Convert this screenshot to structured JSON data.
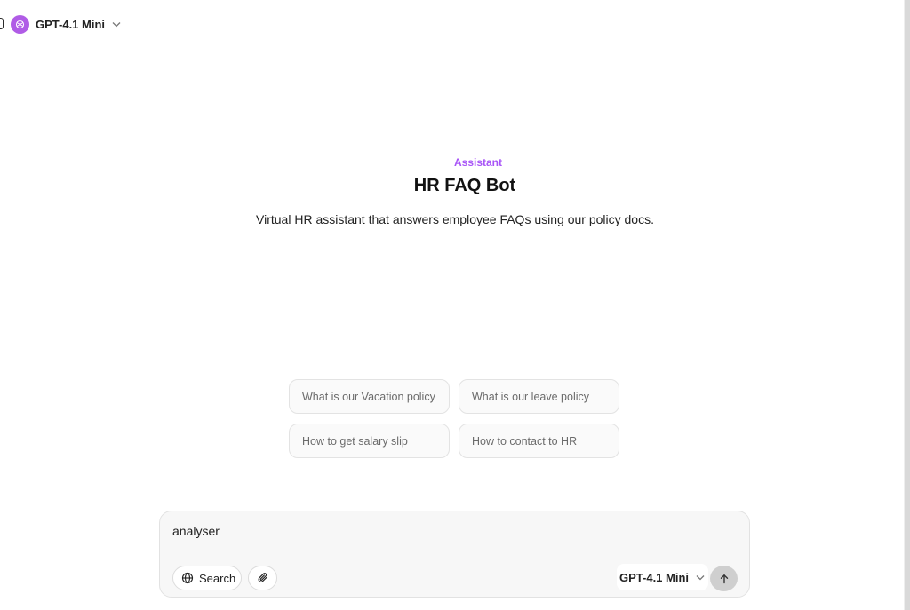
{
  "header": {
    "model_name": "GPT-4.1 Mini",
    "model_logo_icon": "openai-logo-icon",
    "chevron_icon": "chevron-down-icon",
    "sidebar_icon": "sidebar-toggle-icon"
  },
  "assistant": {
    "kicker": "Assistant",
    "name": "HR FAQ Bot",
    "description": "Virtual HR assistant that answers employee FAQs using our policy docs."
  },
  "suggestions": [
    "What is our Vacation policy",
    "What is our leave policy",
    "How to get salary slip",
    "How to contact to HR"
  ],
  "composer": {
    "input_value": "analyser",
    "search_label": "Search",
    "search_icon": "globe-icon",
    "attach_icon": "paperclip-icon",
    "model_label": "GPT-4.1 Mini",
    "send_icon": "arrow-up-icon"
  },
  "colors": {
    "accent": "#a855f7",
    "logo": "#b05ce6",
    "send_button": "#cfcfcf"
  }
}
